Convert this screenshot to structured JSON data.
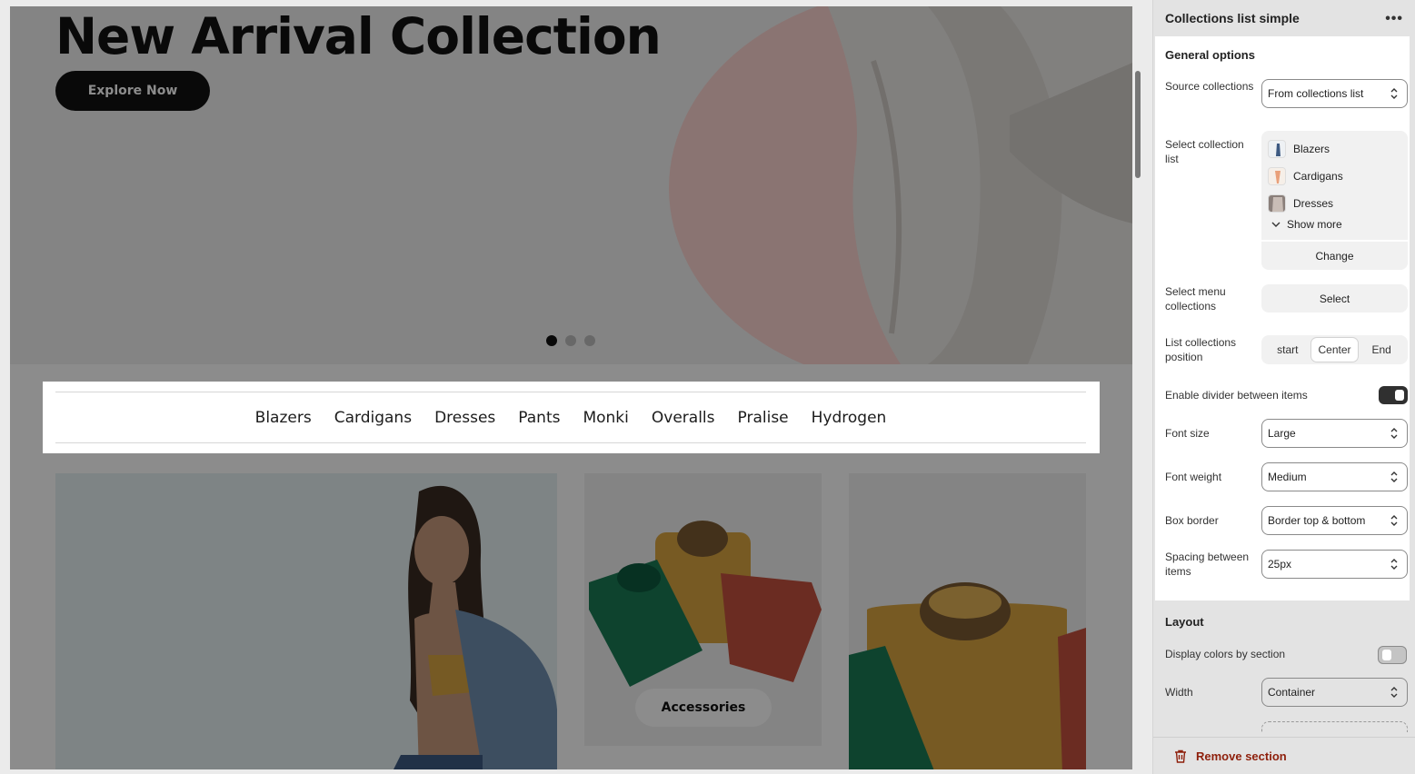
{
  "preview": {
    "hero": {
      "title": "New Arrival Collection",
      "button_label": "Explore Now",
      "slides": 3,
      "active_slide": 1
    },
    "collections_bar": {
      "items": [
        "Blazers",
        "Cardigans",
        "Dresses",
        "Pants",
        "Monki",
        "Overalls",
        "Pralise",
        "Hydrogen"
      ]
    },
    "cards": {
      "accessories_label": "Accessories"
    }
  },
  "panel": {
    "title": "Collections list simple",
    "more_icon": "ellipsis-icon",
    "general": {
      "title": "General options",
      "source_label": "Source collections",
      "source_value": "From collections list",
      "select_list_label": "Select collection list",
      "list_items": [
        "Blazers",
        "Cardigans",
        "Dresses"
      ],
      "show_more": "Show more",
      "change": "Change",
      "menu_label": "Select menu collections",
      "menu_button": "Select",
      "position_label": "List collections position",
      "position_options": [
        "start",
        "Center",
        "End"
      ],
      "position_selected": "Center",
      "divider_label": "Enable divider between items",
      "divider_on": true,
      "font_size_label": "Font size",
      "font_size_value": "Large",
      "font_weight_label": "Font weight",
      "font_weight_value": "Medium",
      "box_border_label": "Box border",
      "box_border_value": "Border top & bottom",
      "spacing_label": "Spacing between items",
      "spacing_value": "25px"
    },
    "layout": {
      "title": "Layout",
      "colors_label": "Display colors by section",
      "colors_on": false,
      "width_label": "Width",
      "width_value": "Container"
    },
    "remove_label": "Remove section",
    "remove_color": "#8e1f0b"
  }
}
